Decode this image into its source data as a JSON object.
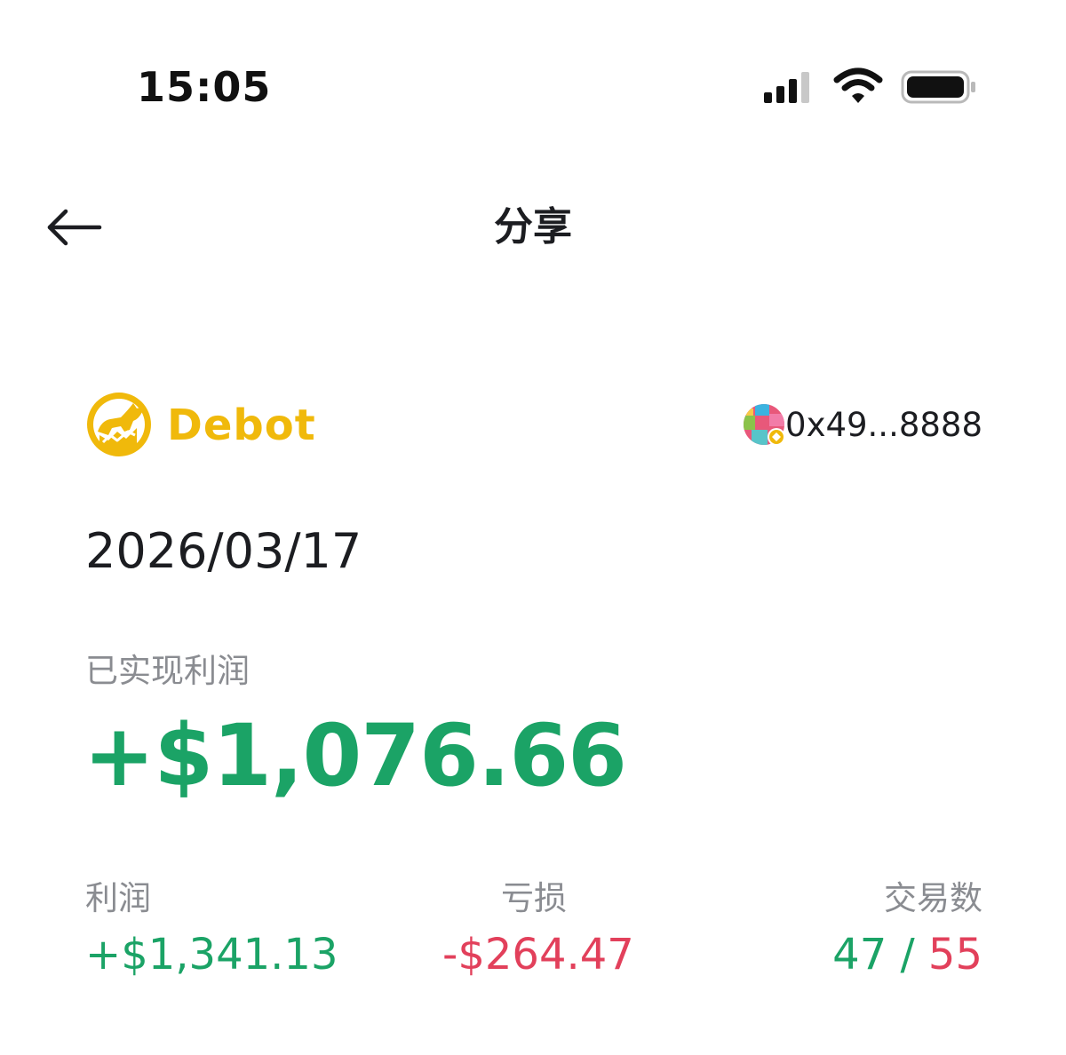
{
  "status_bar": {
    "time": "15:05",
    "icons": [
      "cellular-signal-icon",
      "wifi-icon",
      "battery-icon"
    ]
  },
  "header": {
    "back_icon": "arrow-left-icon",
    "title": "分享"
  },
  "brand": {
    "name": "Debot",
    "logo_icon": "debot-dog-logo",
    "color": "#f0b90b"
  },
  "wallet": {
    "address": "0x49...8888",
    "avatar_icon": "wallet-avatar-icon"
  },
  "report": {
    "date": "2026/03/17",
    "realized_profit_label": "已实现利润",
    "realized_profit_value": "+$1,076.66"
  },
  "stats": {
    "profit_label": "利润",
    "profit_value": "+$1,341.13",
    "loss_label": "亏损",
    "loss_value": "-$264.47",
    "trades_label": "交易数",
    "trades_wins": "47",
    "trades_separator": " / ",
    "trades_total": "55"
  },
  "colors": {
    "profit_green": "#1ba366",
    "loss_red": "#e2405b",
    "muted_gray": "#8a8c91",
    "text_dark": "#1c1d21"
  }
}
